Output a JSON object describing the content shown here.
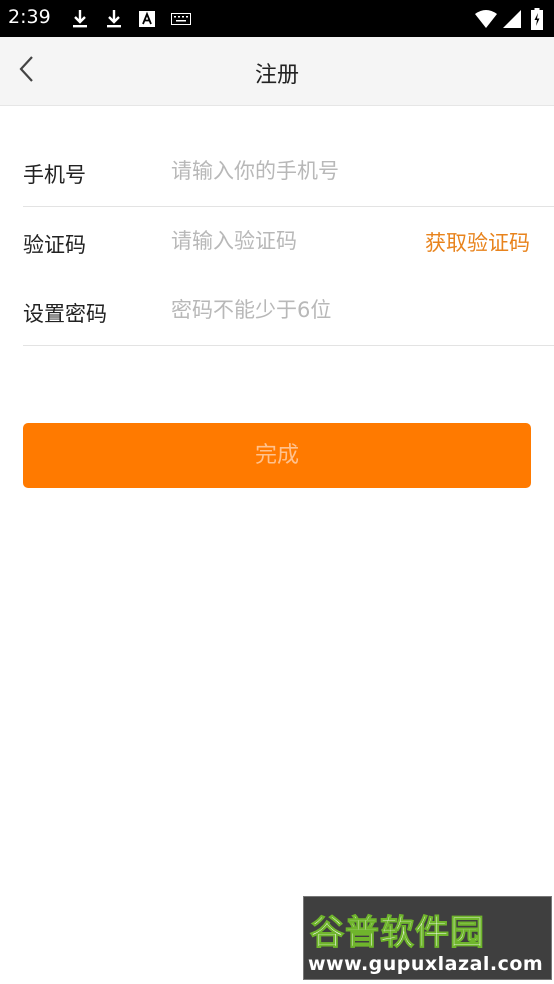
{
  "status_bar": {
    "time": "2:39",
    "icons": [
      "download-icon",
      "download-icon",
      "font-icon",
      "keyboard-icon",
      "wifi-icon",
      "signal-icon",
      "battery-icon"
    ]
  },
  "header": {
    "title": "注册",
    "back_icon": "chevron-left-icon"
  },
  "form": {
    "phone": {
      "label": "手机号",
      "placeholder": "请输入你的手机号",
      "value": ""
    },
    "code": {
      "label": "验证码",
      "placeholder": "请输入验证码",
      "value": "",
      "get_code_label": "获取验证码"
    },
    "password": {
      "label": "设置密码",
      "placeholder": "密码不能少于6位",
      "value": ""
    }
  },
  "submit": {
    "label": "完成"
  },
  "watermark": {
    "title": "谷普软件园",
    "url": "www.gupuxlazal.com"
  },
  "colors": {
    "accent": "#ff7a00",
    "link": "#e8831c",
    "header_bg": "#f5f5f5",
    "status_bar_bg": "#000000"
  }
}
